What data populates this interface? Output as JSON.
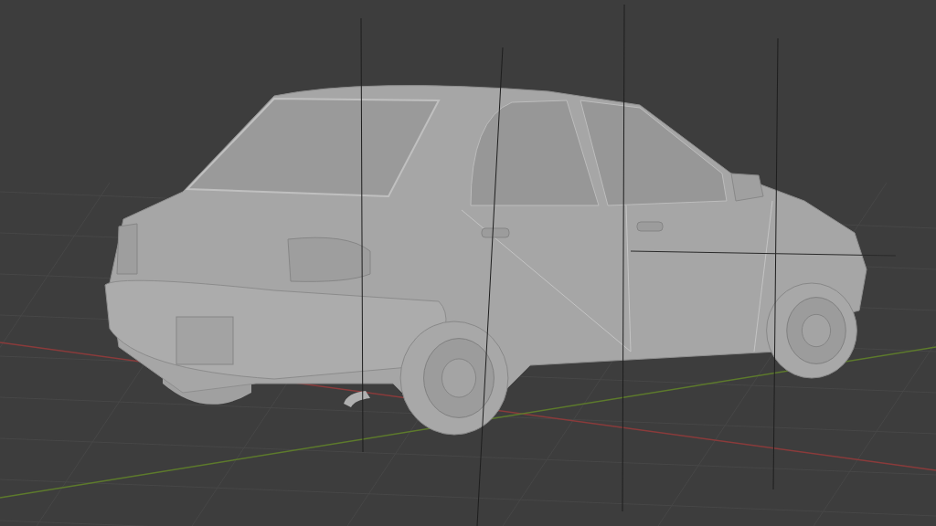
{
  "viewport": {
    "grid_visible": true,
    "axes_visible": true
  }
}
